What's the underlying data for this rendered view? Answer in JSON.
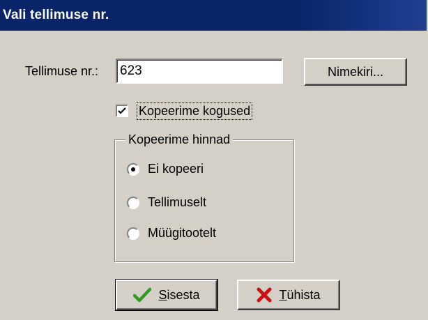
{
  "window": {
    "title": "Vali tellimuse nr."
  },
  "order": {
    "label": "Tellimuse nr.:",
    "value": "623",
    "list_button": "Nimekiri..."
  },
  "copy_quantities": {
    "label": "Kopeerime kogused",
    "checked": true
  },
  "price_group": {
    "title": "Kopeerime hinnad",
    "options": [
      {
        "label": "Ei kopeeri",
        "selected": true
      },
      {
        "label": "Tellimuselt",
        "selected": false
      },
      {
        "label": "Müügitootelt",
        "selected": false
      }
    ]
  },
  "buttons": {
    "submit_mnemonic": "S",
    "submit_rest": "isesta",
    "cancel_mnemonic": "T",
    "cancel_rest": "ühista"
  },
  "icons": {
    "submit": "checkmark-icon",
    "cancel": "red-x-icon"
  },
  "colors": {
    "titlebar": "#0a246a",
    "dialog_bg": "#d4d0c8",
    "check_green": "#2e9a1f",
    "cancel_red": "#cc1010"
  }
}
